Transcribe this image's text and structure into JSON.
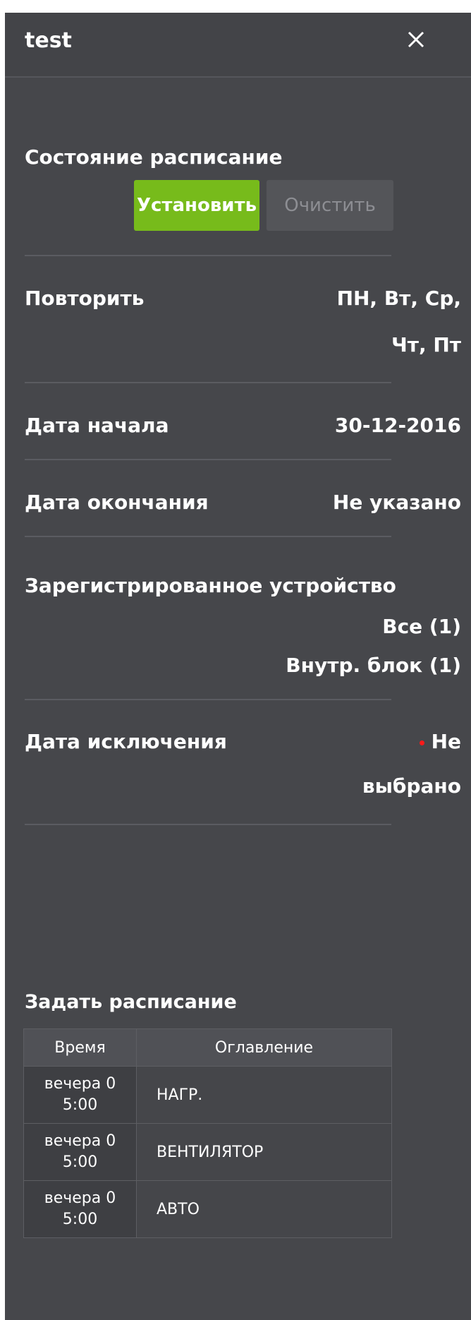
{
  "dialog": {
    "title": "test"
  },
  "schedule_state": {
    "label": "Состояние расписание",
    "set_label": "Установить",
    "clear_label": "Очистить"
  },
  "repeat": {
    "label": "Повторить",
    "value_line1": "ПН, Вт, Ср,",
    "value_line2": "Чт, Пт"
  },
  "start_date": {
    "label": "Дата начала",
    "value": "30-12-2016"
  },
  "end_date": {
    "label": "Дата окончания",
    "value": "Не указано"
  },
  "registered_device": {
    "label": "Зарегистрированное устройство",
    "value_line1": "Все (1)",
    "value_line2": "Внутр. блок (1)"
  },
  "exclusion_date": {
    "label": "Дата исключения",
    "value_line1": "Не",
    "value_line2": "выбрано",
    "indicator_color": "#ff1a1a"
  },
  "set_schedule": {
    "label": "Задать расписание",
    "columns": [
      "Время",
      "Оглавление"
    ],
    "rows": [
      {
        "time_line1": "вечера 0",
        "time_line2": "5:00",
        "content": "НАГР."
      },
      {
        "time_line1": "вечера 0",
        "time_line2": "5:00",
        "content": "ВЕНТИЛЯТОР"
      },
      {
        "time_line1": "вечера 0",
        "time_line2": "5:00",
        "content": "АВТО"
      }
    ]
  },
  "colors": {
    "panel_bg": "#46474b",
    "accent_green": "#77bb1b",
    "disabled_button": "#545559"
  }
}
